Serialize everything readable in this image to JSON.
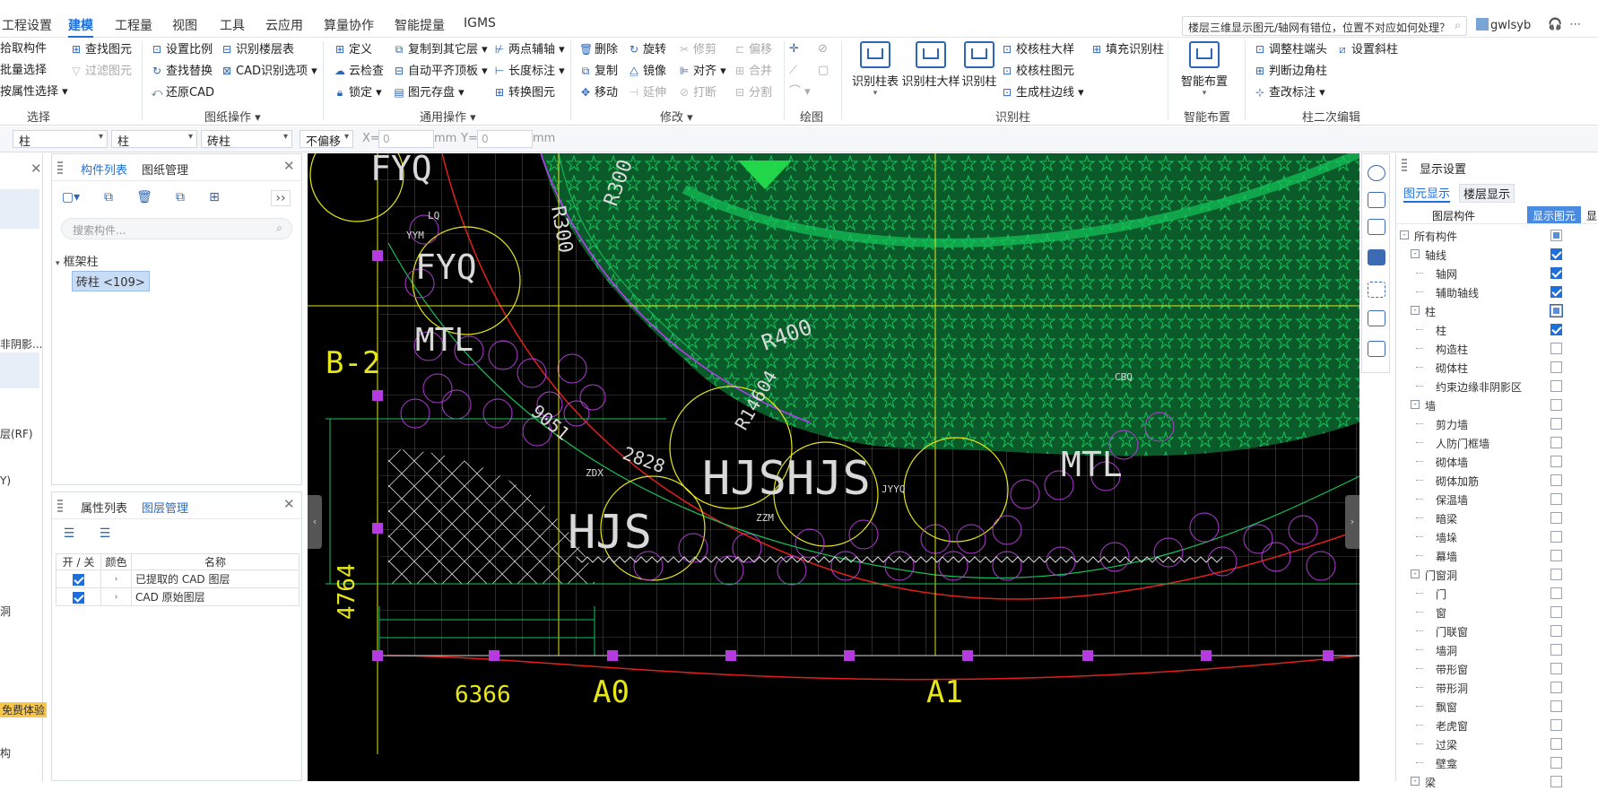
{
  "menu": {
    "items": [
      "工程设置",
      "建模",
      "工程量",
      "视图",
      "工具",
      "云应用",
      "算量协作",
      "智能提量",
      "IGMS"
    ],
    "active": "建模"
  },
  "header": {
    "search_text": "楼层三维显示图元/轴网有错位，位置不对应如何处理？",
    "user": "gwlsyb"
  },
  "ribbon": {
    "select_group": {
      "label": "选择",
      "items": [
        "拾取构件",
        "批量选择",
        "按属性选择"
      ]
    },
    "find_group": {
      "items": [
        "查找图元",
        "过滤图元"
      ]
    },
    "drawing_ops_group": {
      "label": "图纸操作",
      "items": [
        "设置比例",
        "查找替换",
        "还原CAD",
        "识别楼层表",
        "CAD识别选项"
      ]
    },
    "common_ops_group": {
      "label": "通用操作",
      "items": [
        "定义",
        "云检查",
        "锁定",
        "复制到其它层",
        "自动平齐顶板",
        "图元存盘",
        "两点辅轴",
        "长度标注",
        "转换图元"
      ]
    },
    "modify_group": {
      "label": "修改",
      "items": [
        "删除",
        "复制",
        "移动",
        "旋转",
        "镜像",
        "延伸",
        "修剪",
        "对齐",
        "打断",
        "偏移",
        "合并",
        "分割"
      ]
    },
    "draw_group": {
      "label": "绘图"
    },
    "identify_col_group": {
      "label": "识别柱",
      "big": [
        "识别柱表",
        "识别柱大样",
        "识别柱"
      ],
      "items": [
        "校核柱大样",
        "校核柱图元",
        "生成柱边线",
        "填充识别柱"
      ]
    },
    "smart_group": {
      "label": "智能布置",
      "big": "智能布置"
    },
    "col_edit_group": {
      "label": "柱二次编辑",
      "items": [
        "调整柱端头",
        "设置斜柱",
        "判断边角柱",
        "查改标注"
      ]
    }
  },
  "propbar": {
    "combo1": "柱",
    "combo2": "柱",
    "combo3": "砖柱",
    "offset": "不偏移",
    "x_label": "X=",
    "x_value": "0",
    "y_label": "Y=",
    "y_value": "0",
    "unit": "mm"
  },
  "left_strip": {
    "items": [
      "非阴影...",
      "层(RF)",
      "Y)",
      "洞",
      "构"
    ],
    "trial": "免费体验"
  },
  "component_panel": {
    "tabs": [
      "构件列表",
      "图纸管理"
    ],
    "search_placeholder": "搜索构件...",
    "tree_root": "框架柱",
    "tree_child": "砖柱 <109>"
  },
  "layer_panel": {
    "tabs": [
      "属性列表",
      "图层管理"
    ],
    "columns": [
      "开 / 关",
      "颜色",
      "名称"
    ],
    "rows": [
      {
        "on": true,
        "name": "已提取的 CAD 图层"
      },
      {
        "on": true,
        "name": "CAD 原始图层"
      }
    ]
  },
  "canvas": {
    "labels": [
      "B-2",
      "4764",
      "6366",
      "A0",
      "A1",
      "R300",
      "R300",
      "R400",
      "R14604",
      "9051",
      "2828",
      "FYQ",
      "FYQ",
      "MTL",
      "MTL",
      "HJS",
      "HJSHJS",
      "LQ",
      "YYM",
      "ZDX",
      "ZZM",
      "JYYQ",
      "CBQ"
    ],
    "colors": {
      "bg": "#000000",
      "green": "#14c45a",
      "yellow": "#e6e619",
      "purple": "#b23bd6",
      "red": "#e0201c",
      "cyan": "#19c6d6",
      "white": "#d9d9d9",
      "magenta": "#c03aff"
    }
  },
  "display_settings": {
    "title": "显示设置",
    "tabs": [
      "图元显示",
      "楼层显示"
    ],
    "columns": [
      "图层构件",
      "显示图元",
      "显"
    ],
    "rows": [
      {
        "label": "所有构件",
        "level": 0,
        "exp": "-",
        "state": "part"
      },
      {
        "label": "轴线",
        "level": 1,
        "exp": "-",
        "state": "on"
      },
      {
        "label": "轴网",
        "level": 2,
        "state": "on"
      },
      {
        "label": "辅助轴线",
        "level": 2,
        "state": "on"
      },
      {
        "label": "柱",
        "level": 1,
        "exp": "-",
        "state": "part"
      },
      {
        "label": "柱",
        "level": 2,
        "state": "on"
      },
      {
        "label": "构造柱",
        "level": 2,
        "state": "off"
      },
      {
        "label": "砌体柱",
        "level": 2,
        "state": "off"
      },
      {
        "label": "约束边缘非阴影区",
        "level": 2,
        "state": "off"
      },
      {
        "label": "墙",
        "level": 1,
        "exp": "-",
        "state": "off"
      },
      {
        "label": "剪力墙",
        "level": 2,
        "state": "off"
      },
      {
        "label": "人防门框墙",
        "level": 2,
        "state": "off"
      },
      {
        "label": "砌体墙",
        "level": 2,
        "state": "off"
      },
      {
        "label": "砌体加筋",
        "level": 2,
        "state": "off"
      },
      {
        "label": "保温墙",
        "level": 2,
        "state": "off"
      },
      {
        "label": "暗梁",
        "level": 2,
        "state": "off"
      },
      {
        "label": "墙垛",
        "level": 2,
        "state": "off"
      },
      {
        "label": "幕墙",
        "level": 2,
        "state": "off"
      },
      {
        "label": "门窗洞",
        "level": 1,
        "exp": "-",
        "state": "off"
      },
      {
        "label": "门",
        "level": 2,
        "state": "off"
      },
      {
        "label": "窗",
        "level": 2,
        "state": "off"
      },
      {
        "label": "门联窗",
        "level": 2,
        "state": "off"
      },
      {
        "label": "墙洞",
        "level": 2,
        "state": "off"
      },
      {
        "label": "带形窗",
        "level": 2,
        "state": "off"
      },
      {
        "label": "带形洞",
        "level": 2,
        "state": "off"
      },
      {
        "label": "飘窗",
        "level": 2,
        "state": "off"
      },
      {
        "label": "老虎窗",
        "level": 2,
        "state": "off"
      },
      {
        "label": "过梁",
        "level": 2,
        "state": "off"
      },
      {
        "label": "壁龛",
        "level": 2,
        "state": "off"
      },
      {
        "label": "梁",
        "level": 1,
        "exp": "-",
        "state": "off"
      }
    ]
  }
}
